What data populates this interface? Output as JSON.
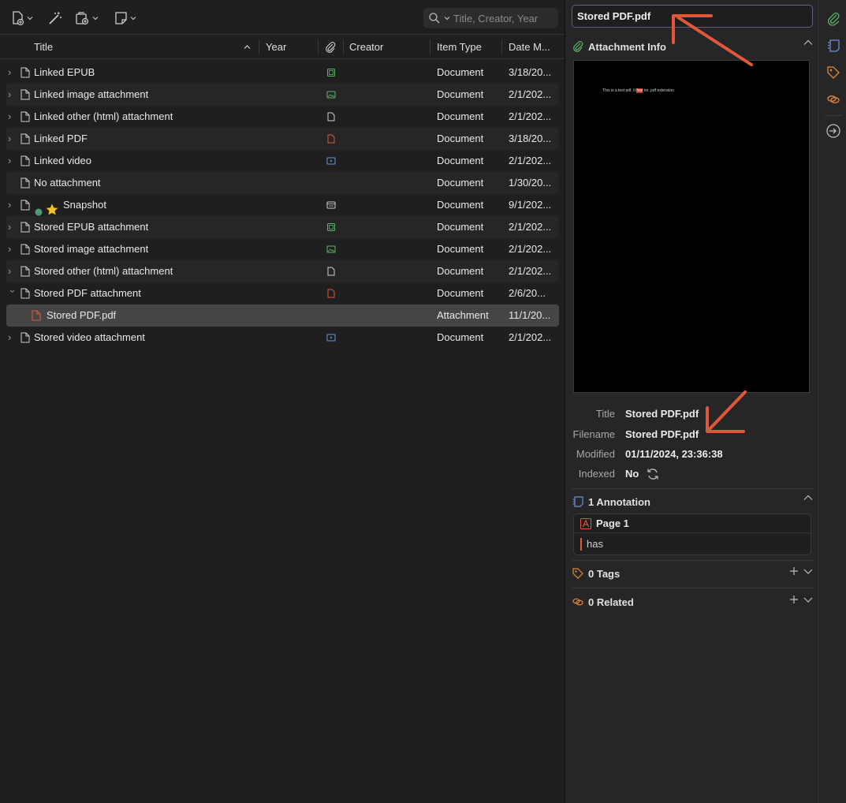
{
  "search": {
    "placeholder": "Title, Creator, Year"
  },
  "columns": {
    "title": "Title",
    "year": "Year",
    "creator": "Creator",
    "item_type": "Item Type",
    "date_modified": "Date M..."
  },
  "items": [
    {
      "title": "Linked EPUB",
      "type": "Document",
      "date": "3/18/20...",
      "attachment": "epub-icon"
    },
    {
      "title": "Linked image attachment",
      "type": "Document",
      "date": "2/1/202...",
      "attachment": "image-icon"
    },
    {
      "title": "Linked other (html) attachment",
      "type": "Document",
      "date": "2/1/202...",
      "attachment": "file-icon"
    },
    {
      "title": "Linked PDF",
      "type": "Document",
      "date": "3/18/20...",
      "attachment": "pdf-icon"
    },
    {
      "title": "Linked video",
      "type": "Document",
      "date": "2/1/202...",
      "attachment": "video-icon"
    },
    {
      "title": "No attachment",
      "type": "Document",
      "date": "1/30/20...",
      "attachment": ""
    },
    {
      "title": "Snapshot",
      "type": "Document",
      "date": "9/1/202...",
      "attachment": "snapshot-icon"
    },
    {
      "title": "Stored EPUB attachment",
      "type": "Document",
      "date": "2/1/202...",
      "attachment": "epub-icon"
    },
    {
      "title": "Stored image attachment",
      "type": "Document",
      "date": "2/1/202...",
      "attachment": "image-icon"
    },
    {
      "title": "Stored other (html) attachment",
      "type": "Document",
      "date": "2/1/202...",
      "attachment": "file-icon"
    },
    {
      "title": "Stored PDF attachment",
      "type": "Document",
      "date": "2/6/20...",
      "attachment": "pdf-icon"
    },
    {
      "title": "Stored PDF.pdf",
      "type": "Attachment",
      "date": "11/1/20...",
      "attachment": ""
    },
    {
      "title": "Stored video attachment",
      "type": "Document",
      "date": "2/1/202...",
      "attachment": "video-icon"
    }
  ],
  "pane": {
    "title_field": "Stored PDF.pdf",
    "attachment_info_label": "Attachment Info",
    "preview_text_before": "This is a test pdf. It ",
    "preview_text_highlight": "has",
    "preview_text_after": " no .pdf extension",
    "meta": {
      "title_label": "Title",
      "title_value": "Stored PDF.pdf",
      "filename_label": "Filename",
      "filename_value": "Stored PDF.pdf",
      "modified_label": "Modified",
      "modified_value": "01/11/2024, 23:36:38",
      "indexed_label": "Indexed",
      "indexed_value": "No"
    },
    "annotations_label": "1 Annotation",
    "annotation_page": "Page 1",
    "annotation_text": "has",
    "tags_label": "0 Tags",
    "related_label": "0 Related"
  },
  "colors": {
    "accent_arrow": "#e0573b",
    "selected_row": "#454545",
    "title_border": "#6b5a86"
  }
}
